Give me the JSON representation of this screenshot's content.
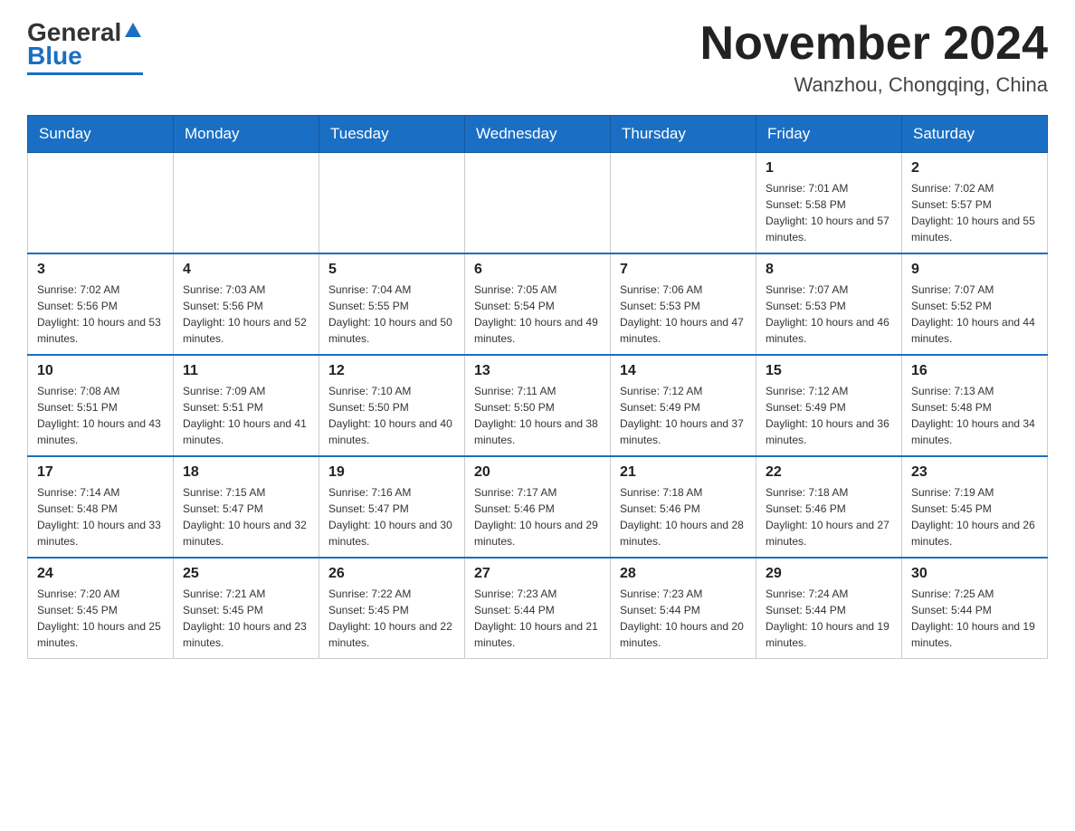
{
  "header": {
    "logo": {
      "general": "General",
      "blue": "Blue"
    },
    "title": "November 2024",
    "location": "Wanzhou, Chongqing, China"
  },
  "days_of_week": [
    "Sunday",
    "Monday",
    "Tuesday",
    "Wednesday",
    "Thursday",
    "Friday",
    "Saturday"
  ],
  "weeks": [
    [
      {
        "day": "",
        "info": ""
      },
      {
        "day": "",
        "info": ""
      },
      {
        "day": "",
        "info": ""
      },
      {
        "day": "",
        "info": ""
      },
      {
        "day": "",
        "info": ""
      },
      {
        "day": "1",
        "info": "Sunrise: 7:01 AM\nSunset: 5:58 PM\nDaylight: 10 hours and 57 minutes."
      },
      {
        "day": "2",
        "info": "Sunrise: 7:02 AM\nSunset: 5:57 PM\nDaylight: 10 hours and 55 minutes."
      }
    ],
    [
      {
        "day": "3",
        "info": "Sunrise: 7:02 AM\nSunset: 5:56 PM\nDaylight: 10 hours and 53 minutes."
      },
      {
        "day": "4",
        "info": "Sunrise: 7:03 AM\nSunset: 5:56 PM\nDaylight: 10 hours and 52 minutes."
      },
      {
        "day": "5",
        "info": "Sunrise: 7:04 AM\nSunset: 5:55 PM\nDaylight: 10 hours and 50 minutes."
      },
      {
        "day": "6",
        "info": "Sunrise: 7:05 AM\nSunset: 5:54 PM\nDaylight: 10 hours and 49 minutes."
      },
      {
        "day": "7",
        "info": "Sunrise: 7:06 AM\nSunset: 5:53 PM\nDaylight: 10 hours and 47 minutes."
      },
      {
        "day": "8",
        "info": "Sunrise: 7:07 AM\nSunset: 5:53 PM\nDaylight: 10 hours and 46 minutes."
      },
      {
        "day": "9",
        "info": "Sunrise: 7:07 AM\nSunset: 5:52 PM\nDaylight: 10 hours and 44 minutes."
      }
    ],
    [
      {
        "day": "10",
        "info": "Sunrise: 7:08 AM\nSunset: 5:51 PM\nDaylight: 10 hours and 43 minutes."
      },
      {
        "day": "11",
        "info": "Sunrise: 7:09 AM\nSunset: 5:51 PM\nDaylight: 10 hours and 41 minutes."
      },
      {
        "day": "12",
        "info": "Sunrise: 7:10 AM\nSunset: 5:50 PM\nDaylight: 10 hours and 40 minutes."
      },
      {
        "day": "13",
        "info": "Sunrise: 7:11 AM\nSunset: 5:50 PM\nDaylight: 10 hours and 38 minutes."
      },
      {
        "day": "14",
        "info": "Sunrise: 7:12 AM\nSunset: 5:49 PM\nDaylight: 10 hours and 37 minutes."
      },
      {
        "day": "15",
        "info": "Sunrise: 7:12 AM\nSunset: 5:49 PM\nDaylight: 10 hours and 36 minutes."
      },
      {
        "day": "16",
        "info": "Sunrise: 7:13 AM\nSunset: 5:48 PM\nDaylight: 10 hours and 34 minutes."
      }
    ],
    [
      {
        "day": "17",
        "info": "Sunrise: 7:14 AM\nSunset: 5:48 PM\nDaylight: 10 hours and 33 minutes."
      },
      {
        "day": "18",
        "info": "Sunrise: 7:15 AM\nSunset: 5:47 PM\nDaylight: 10 hours and 32 minutes."
      },
      {
        "day": "19",
        "info": "Sunrise: 7:16 AM\nSunset: 5:47 PM\nDaylight: 10 hours and 30 minutes."
      },
      {
        "day": "20",
        "info": "Sunrise: 7:17 AM\nSunset: 5:46 PM\nDaylight: 10 hours and 29 minutes."
      },
      {
        "day": "21",
        "info": "Sunrise: 7:18 AM\nSunset: 5:46 PM\nDaylight: 10 hours and 28 minutes."
      },
      {
        "day": "22",
        "info": "Sunrise: 7:18 AM\nSunset: 5:46 PM\nDaylight: 10 hours and 27 minutes."
      },
      {
        "day": "23",
        "info": "Sunrise: 7:19 AM\nSunset: 5:45 PM\nDaylight: 10 hours and 26 minutes."
      }
    ],
    [
      {
        "day": "24",
        "info": "Sunrise: 7:20 AM\nSunset: 5:45 PM\nDaylight: 10 hours and 25 minutes."
      },
      {
        "day": "25",
        "info": "Sunrise: 7:21 AM\nSunset: 5:45 PM\nDaylight: 10 hours and 23 minutes."
      },
      {
        "day": "26",
        "info": "Sunrise: 7:22 AM\nSunset: 5:45 PM\nDaylight: 10 hours and 22 minutes."
      },
      {
        "day": "27",
        "info": "Sunrise: 7:23 AM\nSunset: 5:44 PM\nDaylight: 10 hours and 21 minutes."
      },
      {
        "day": "28",
        "info": "Sunrise: 7:23 AM\nSunset: 5:44 PM\nDaylight: 10 hours and 20 minutes."
      },
      {
        "day": "29",
        "info": "Sunrise: 7:24 AM\nSunset: 5:44 PM\nDaylight: 10 hours and 19 minutes."
      },
      {
        "day": "30",
        "info": "Sunrise: 7:25 AM\nSunset: 5:44 PM\nDaylight: 10 hours and 19 minutes."
      }
    ]
  ]
}
